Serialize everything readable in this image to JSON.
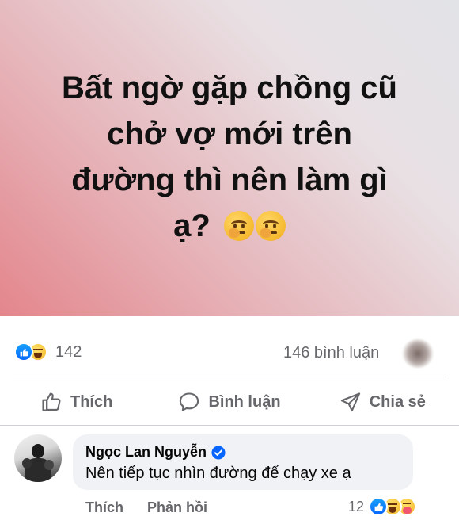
{
  "post": {
    "banner_line1": "Bất ngờ gặp chồng cũ",
    "banner_line2": "chở vợ mới trên",
    "banner_line3": "đường thì nên làm gì",
    "banner_line4": "ạ?",
    "banner_emojis": [
      "thinking-face-emoji",
      "thinking-face-emoji"
    ],
    "banner_colors": [
      "#e3868c",
      "#e8e0e3",
      "#e2e3e7"
    ]
  },
  "stats": {
    "reaction_count": "142",
    "reaction_icons": [
      "like-icon",
      "haha-icon"
    ],
    "comment_count": "146 bình luận"
  },
  "actions": {
    "like_label": "Thích",
    "comment_label": "Bình luận",
    "share_label": "Chia sẻ"
  },
  "comment": {
    "author": "Ngọc Lan Nguyễn",
    "verified": true,
    "text": "Nên tiếp tục nhìn đường để chạy xe ạ",
    "like_label": "Thích",
    "reply_label": "Phản hồi",
    "reaction_count": "12",
    "reaction_icons": [
      "like-icon",
      "haha-icon",
      "care-icon"
    ]
  },
  "colors": {
    "accent": "#0866ff",
    "secondary_text": "#65676b",
    "bubble_bg": "#f0f2f5"
  }
}
